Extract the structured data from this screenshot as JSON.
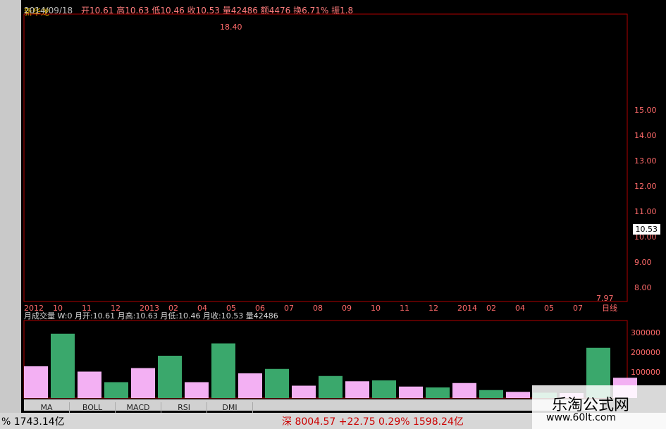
{
  "app": {
    "title": "新华龙"
  },
  "header": {
    "date": "2014/09/18",
    "open": "开10.61",
    "high": "高10.63",
    "low": "低10.46",
    "close": "收10.53",
    "vol": "量42486",
    "amt": "额4476",
    "turn": "换6.71%",
    "swing": "振1.8"
  },
  "chart_top": {
    "label": "18.40"
  },
  "volume": {
    "title": "月成交量",
    "w": "W:0",
    "mopen": "月开:10.61",
    "mhigh": "月高:10.63",
    "mlow": "月低:10.46",
    "mclose": "月收:10.53",
    "vol": "量42486"
  },
  "tabs": [
    "MA",
    "BOLL",
    "MACD",
    "RSI",
    "DMI"
  ],
  "status": {
    "a": "% 1743.14亿",
    "b": "深 8004.57 +22.75 0.29% 1598.24亿"
  },
  "watermark": {
    "title": "乐淘公式网",
    "url": "www.60lt.com"
  },
  "chart_data": [
    {
      "type": "bar",
      "title": "",
      "x": [
        "2012",
        "10",
        "11",
        "12",
        "2013",
        "02",
        "04",
        "05",
        "06",
        "07",
        "08",
        "09",
        "10",
        "11",
        "12",
        "2014",
        "02",
        "04",
        "05",
        "07",
        "日线"
      ],
      "y_ticks": [
        "15.00",
        "14.00",
        "13.00",
        "12.00",
        "11.00",
        "10.00",
        "9.00",
        "8.00"
      ],
      "last": "10.53",
      "low_label": "7.97"
    },
    {
      "type": "bar",
      "title": "",
      "y_ticks": [
        "300000",
        "200000",
        "100000"
      ],
      "values": [
        180000,
        365000,
        150000,
        90000,
        170000,
        240000,
        90000,
        310000,
        140000,
        165000,
        70000,
        125000,
        95000,
        100000,
        65000,
        60000,
        85000,
        45000,
        35000,
        30000,
        28000,
        285000,
        115000
      ]
    }
  ]
}
